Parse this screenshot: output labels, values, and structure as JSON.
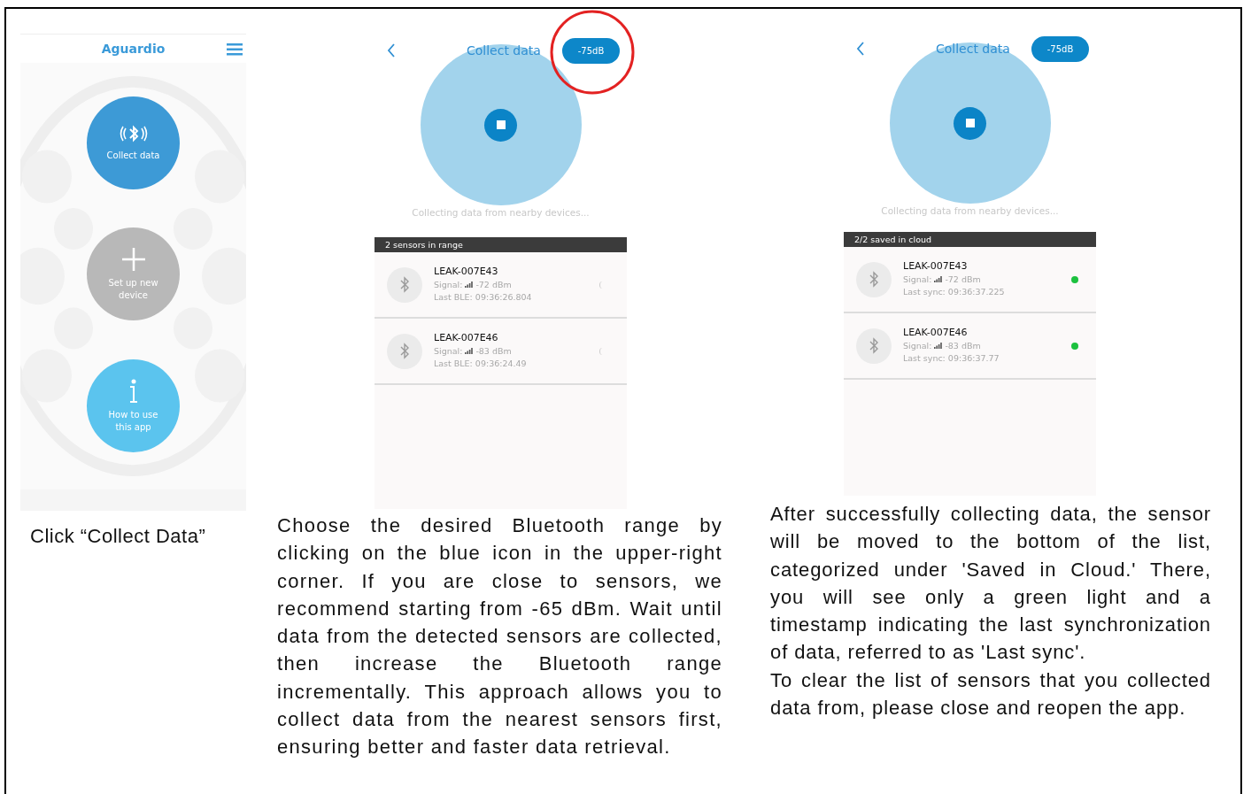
{
  "home_screen": {
    "logo": "Aguardio",
    "buttons": [
      {
        "kind": "collect",
        "label": "Collect data"
      },
      {
        "kind": "setup",
        "label": "Set up new device"
      },
      {
        "kind": "help",
        "label": "How to use this app"
      }
    ],
    "caption": "Click “Collect Data”"
  },
  "collect_screens": [
    {
      "title": "Collect data",
      "range": "-75dB",
      "highlighted": true,
      "status": "Collecting data from nearby devices...",
      "list_header": "2 sensors in range",
      "sensors": [
        {
          "name": "LEAK-007E43",
          "signal_label": "Signal:",
          "signal": "-72 dBm",
          "time": "Last BLE: 09:36:26.804",
          "synced": false
        },
        {
          "name": "LEAK-007E46",
          "signal_label": "Signal:",
          "signal": "-83 dBm",
          "time": "Last BLE: 09:36:24.49",
          "synced": false
        }
      ],
      "caption": [
        "Choose the desired Bluetooth range by clicking on the blue icon in the upper-right corner. If you are close to sensors, we recommend starting from -65 dBm. Wait until data from the detected sensors are collected, then increase the Bluetooth range incrementally. This approach allows you to collect data from the nearest sensors first, ensuring better and faster data retrieval."
      ]
    },
    {
      "title": "Collect data",
      "range": "-75dB",
      "highlighted": false,
      "status": "Collecting data from nearby devices...",
      "list_header": "2/2 saved in cloud",
      "sensors": [
        {
          "name": "LEAK-007E43",
          "signal_label": "Signal:",
          "signal": "-72 dBm",
          "time": "Last sync: 09:36:37.225",
          "synced": true
        },
        {
          "name": "LEAK-007E46",
          "signal_label": "Signal:",
          "signal": "-83 dBm",
          "time": "Last sync: 09:36:37.77",
          "synced": true
        }
      ],
      "caption": [
        "After successfully collecting data, the sensor will be moved to the bottom of the list, categorized under 'Saved in Cloud.' There, you will see only a green light and a timestamp indicating the last synchronization of data, referred to as 'Last sync'.",
        "To clear the list of sensors that you collected data from, please close and reopen the app."
      ]
    }
  ]
}
